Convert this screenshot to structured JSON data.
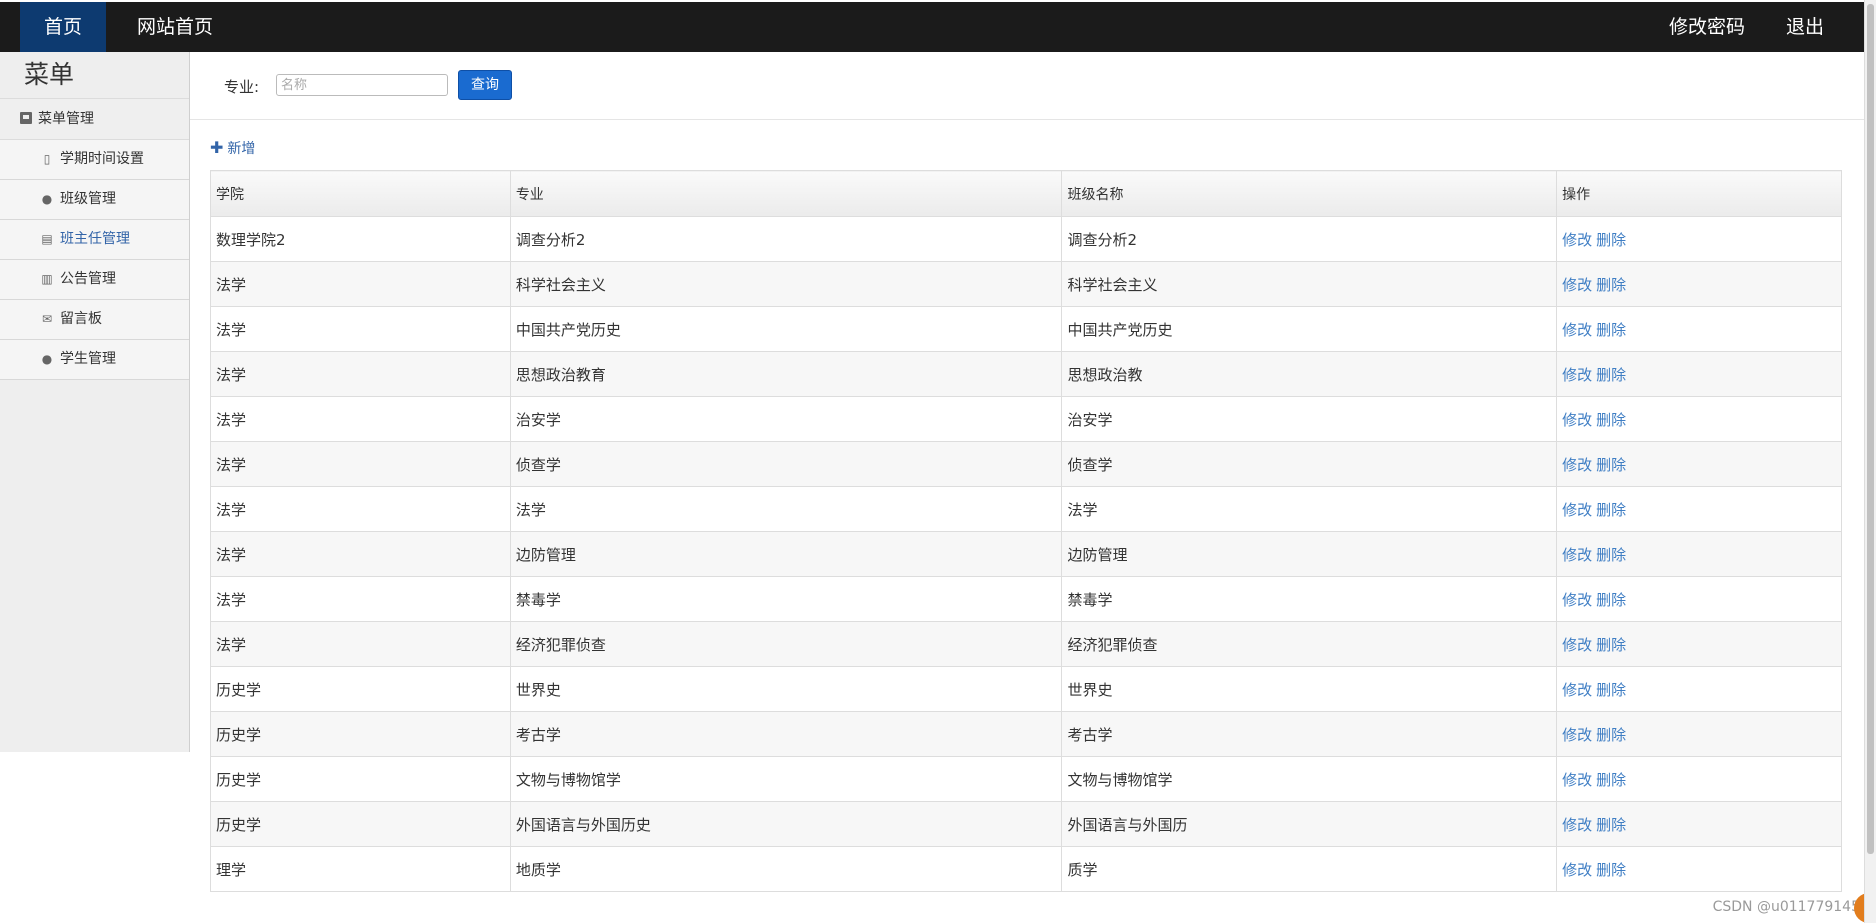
{
  "topnav": {
    "home": "首页",
    "site_home": "网站首页",
    "change_password": "修改密码",
    "logout": "退出"
  },
  "sidebar": {
    "title": "菜单",
    "group": "菜单管理",
    "items": [
      {
        "label": "学期时间设置",
        "icon": "document-icon"
      },
      {
        "label": "班级管理",
        "icon": "chat-bubble-icon"
      },
      {
        "label": "班主任管理",
        "icon": "list-icon",
        "active": true
      },
      {
        "label": "公告管理",
        "icon": "books-icon"
      },
      {
        "label": "留言板",
        "icon": "envelope-icon"
      },
      {
        "label": "学生管理",
        "icon": "chat-bubble-icon"
      }
    ]
  },
  "search": {
    "label": "专业:",
    "placeholder": "名称",
    "button": "查询"
  },
  "actions": {
    "add_label": "新增"
  },
  "table": {
    "headers": [
      "学院",
      "专业",
      "班级名称",
      "操作"
    ],
    "edit_label": "修改",
    "delete_label": "删除",
    "rows": [
      [
        "数理学院2",
        "调查分析2",
        "调查分析2"
      ],
      [
        "法学",
        "科学社会主义",
        "科学社会主义"
      ],
      [
        "法学",
        "中国共产党历史",
        "中国共产党历史"
      ],
      [
        "法学",
        "思想政治教育",
        "思想政治教"
      ],
      [
        "法学",
        "治安学",
        "治安学"
      ],
      [
        "法学",
        "侦查学",
        "侦查学"
      ],
      [
        "法学",
        "法学",
        "法学"
      ],
      [
        "法学",
        "边防管理",
        "边防管理"
      ],
      [
        "法学",
        "禁毒学",
        "禁毒学"
      ],
      [
        "法学",
        "经济犯罪侦查",
        "经济犯罪侦查"
      ],
      [
        "历史学",
        "世界史",
        "世界史"
      ],
      [
        "历史学",
        "考古学",
        "考古学"
      ],
      [
        "历史学",
        "文物与博物馆学",
        "文物与博物馆学"
      ],
      [
        "历史学",
        "外国语言与外国历史",
        "外国语言与外国历"
      ],
      [
        "理学",
        "地质学",
        "质学"
      ]
    ]
  },
  "watermark": "CSDN @u011779145",
  "colors": {
    "topbar_bg": "#1b1b1b",
    "active_tab": "#0d3a70",
    "link": "#3f7ec4",
    "button": "#1a6bd0"
  }
}
